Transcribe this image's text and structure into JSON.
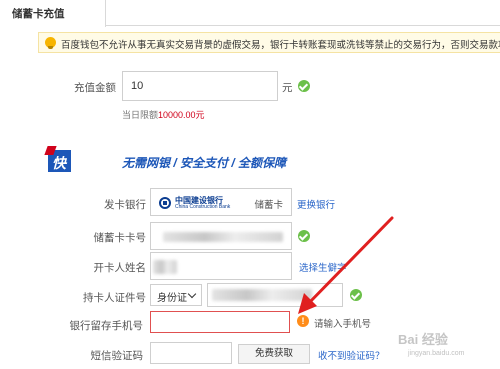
{
  "tab": {
    "label": "储蓄卡充值"
  },
  "notice": {
    "text": "百度钱包不允许从事无真实交易背景的虚假交易，银行卡转账套现或洗钱等禁止的交易行为，否则交易款项将不能提现"
  },
  "amount": {
    "label": "充值金额",
    "value": "10",
    "unit": "元",
    "limit_prefix": "当日限额",
    "limit_value": "10000.00元"
  },
  "brand": {
    "badge": "快捷支付",
    "slogan": "无需网银 / 安全支付 / 全额保障"
  },
  "bank": {
    "label": "发卡银行",
    "name": "中国建设银行",
    "name_en": "China Construction Bank",
    "card_type": "储蓄卡",
    "change_link": "更换银行"
  },
  "card_number": {
    "label": "储蓄卡卡号"
  },
  "holder_name": {
    "label": "开卡人姓名",
    "rare_char_link": "选择生僻字"
  },
  "id_number": {
    "label": "持卡人证件号",
    "id_type": "身份证"
  },
  "phone": {
    "label": "银行留存手机号",
    "hint": "请输入手机号"
  },
  "sms": {
    "label": "短信验证码",
    "button": "免费获取",
    "no_code_link": "收不到验证码？"
  },
  "watermark": {
    "text": "Bai 经验",
    "url": "jingyan.baidu.com"
  },
  "colors": {
    "accent_blue": "#1d57b8",
    "ok_green": "#6cc04a",
    "warn_orange": "#ff8c1a",
    "arrow_red": "#e02020",
    "limit_red": "#d0021b"
  },
  "icons": [
    "lightbulb-icon",
    "check-icon",
    "warning-icon",
    "chevron-down-icon",
    "bank-logo-icon",
    "arrow-annotation"
  ]
}
